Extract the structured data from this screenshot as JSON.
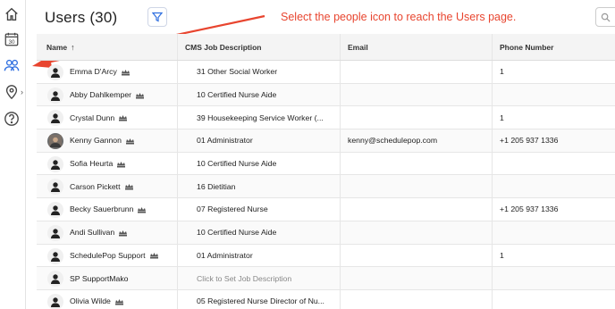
{
  "page": {
    "title": "Users (30)",
    "annotation": "Select the people icon to reach the Users page."
  },
  "sidebar": {
    "items": [
      {
        "icon": "home-icon"
      },
      {
        "icon": "calendar-icon",
        "label": "30"
      },
      {
        "icon": "people-icon",
        "active": true
      },
      {
        "icon": "location-icon"
      },
      {
        "icon": "help-icon"
      }
    ]
  },
  "table": {
    "columns": [
      "Name",
      "CMS Job Description",
      "Email",
      "Phone Number"
    ],
    "sort_indicator": "↑",
    "rows": [
      {
        "name": "Emma D'Arcy",
        "crown": true,
        "job": "31 Other Social Worker",
        "email": "",
        "phone": "1",
        "photo": false
      },
      {
        "name": "Abby Dahlkemper",
        "crown": true,
        "job": "10 Certified Nurse Aide",
        "email": "",
        "phone": "",
        "photo": false
      },
      {
        "name": "Crystal Dunn",
        "crown": true,
        "job": "39 Housekeeping Service Worker (...",
        "email": "",
        "phone": "1",
        "photo": false
      },
      {
        "name": "Kenny Gannon",
        "crown": true,
        "job": "01 Administrator",
        "email": "kenny@schedulepop.com",
        "phone": "+1 205 937 1336",
        "photo": true
      },
      {
        "name": "Sofia Heurta",
        "crown": true,
        "job": "10 Certified Nurse Aide",
        "email": "",
        "phone": "",
        "photo": false
      },
      {
        "name": "Carson Pickett",
        "crown": true,
        "job": "16 Dietitian",
        "email": "",
        "phone": "",
        "photo": false
      },
      {
        "name": "Becky Sauerbrunn",
        "crown": true,
        "job": "07 Registered Nurse",
        "email": "",
        "phone": "+1 205 937 1336",
        "photo": false
      },
      {
        "name": "Andi Sullivan",
        "crown": true,
        "job": "10 Certified Nurse Aide",
        "email": "",
        "phone": "",
        "photo": false
      },
      {
        "name": "SchedulePop Support",
        "crown": true,
        "job": "01 Administrator",
        "email": "",
        "phone": "1",
        "photo": false
      },
      {
        "name": "SP SupportMako",
        "crown": false,
        "job": "Click to Set Job Description",
        "job_placeholder": true,
        "email": "",
        "phone": "",
        "photo": false
      },
      {
        "name": "Olivia Wilde",
        "crown": true,
        "job": "05 Registered Nurse Director of Nu...",
        "email": "",
        "phone": "",
        "photo": false
      }
    ]
  },
  "colors": {
    "annotation": "#e8452f",
    "active_icon": "#2f6fe0",
    "filter": "#2f6fe0"
  }
}
